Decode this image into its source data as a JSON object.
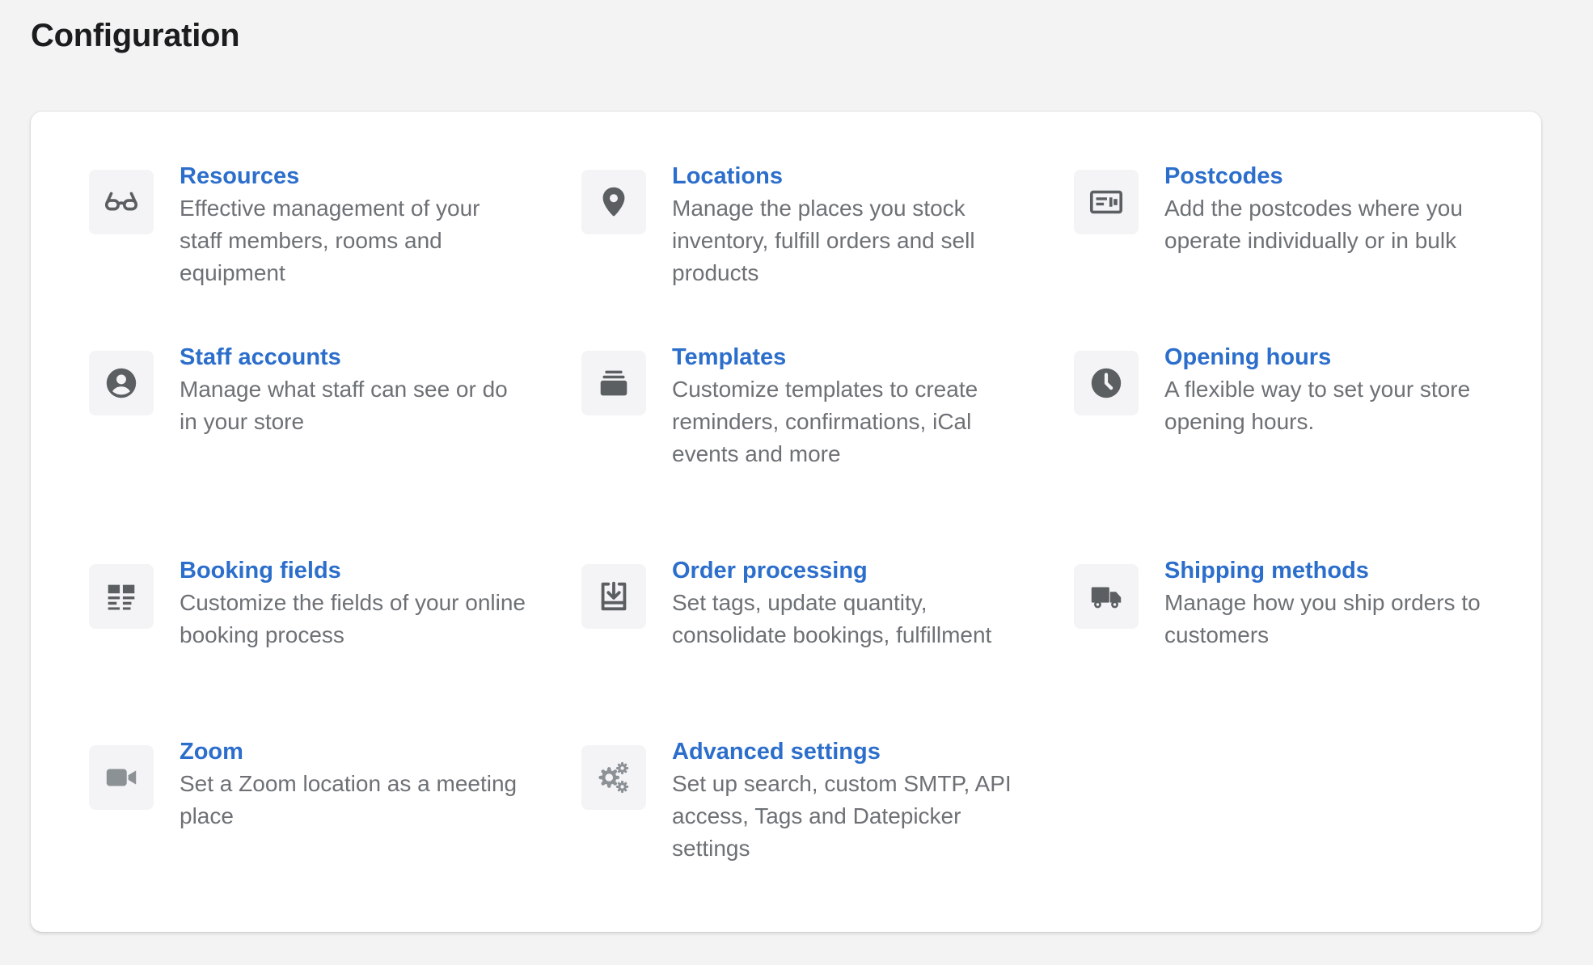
{
  "page": {
    "title": "Configuration"
  },
  "colors": {
    "accent": "#2c6ecb",
    "icon": "#5c5f62",
    "icon_muted": "#8c9196",
    "text_subdued": "#6d7175"
  },
  "items": [
    {
      "title": "Resources",
      "desc": "Effective management of your staff members, rooms and equipment",
      "icon": "glasses-icon"
    },
    {
      "title": "Locations",
      "desc": "Manage the places you stock inventory, fulfill orders and sell products",
      "icon": "location-pin-icon"
    },
    {
      "title": "Postcodes",
      "desc": "Add the postcodes where you operate individually or in bulk",
      "icon": "postcode-card-icon"
    },
    {
      "title": "Staff accounts",
      "desc": "Manage what staff can see or do in your store",
      "icon": "user-circle-icon"
    },
    {
      "title": "Templates",
      "desc": "Customize templates to create reminders, confirmations, iCal events and more",
      "icon": "template-stack-icon"
    },
    {
      "title": "Opening hours",
      "desc": "A flexible way to set your store opening hours.",
      "icon": "clock-icon"
    },
    {
      "title": "Booking fields",
      "desc": "Customize the fields of your online booking process",
      "icon": "form-fields-icon"
    },
    {
      "title": "Order processing",
      "desc": "Set tags, update quantity, consolidate bookings, fulfillment",
      "icon": "import-box-icon"
    },
    {
      "title": "Shipping methods",
      "desc": "Manage how you ship orders to customers",
      "icon": "truck-icon"
    },
    {
      "title": "Zoom",
      "desc": "Set a Zoom location as a meeting place",
      "icon": "video-camera-icon"
    },
    {
      "title": "Advanced settings",
      "desc": "Set up search, custom SMTP, API access, Tags and Datepicker settings",
      "icon": "gears-icon"
    }
  ]
}
